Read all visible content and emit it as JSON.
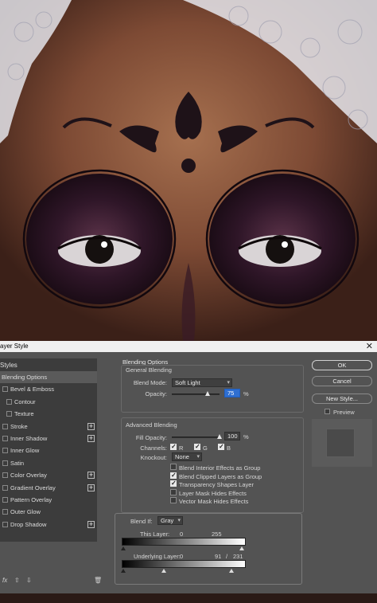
{
  "dialog": {
    "title": "ayer Style",
    "close_icon": "close-icon"
  },
  "style_list": {
    "header": "Styles",
    "items": [
      {
        "label": "Blending Options",
        "checkbox": false,
        "plus": false,
        "indent": 0,
        "selected": true
      },
      {
        "label": "Bevel & Emboss",
        "checkbox": true,
        "plus": false,
        "indent": 0
      },
      {
        "label": "Contour",
        "checkbox": true,
        "plus": false,
        "indent": 1
      },
      {
        "label": "Texture",
        "checkbox": true,
        "plus": false,
        "indent": 1
      },
      {
        "label": "Stroke",
        "checkbox": true,
        "plus": true,
        "indent": 0
      },
      {
        "label": "Inner Shadow",
        "checkbox": true,
        "plus": true,
        "indent": 0
      },
      {
        "label": "Inner Glow",
        "checkbox": true,
        "plus": false,
        "indent": 0
      },
      {
        "label": "Satin",
        "checkbox": true,
        "plus": false,
        "indent": 0
      },
      {
        "label": "Color Overlay",
        "checkbox": true,
        "plus": true,
        "indent": 0
      },
      {
        "label": "Gradient Overlay",
        "checkbox": true,
        "plus": true,
        "indent": 0
      },
      {
        "label": "Pattern Overlay",
        "checkbox": true,
        "plus": false,
        "indent": 0
      },
      {
        "label": "Outer Glow",
        "checkbox": true,
        "plus": false,
        "indent": 0
      },
      {
        "label": "Drop Shadow",
        "checkbox": true,
        "plus": true,
        "indent": 0
      }
    ],
    "fx_label": "fx",
    "fx_dot": ".",
    "up_icon": "arrow-up-icon",
    "down_icon": "arrow-down-icon",
    "trash_icon": "trash-icon"
  },
  "blending": {
    "section_title": "Blending Options",
    "general_title": "General Blending",
    "blend_mode_label": "Blend Mode:",
    "blend_mode_value": "Soft Light",
    "opacity_label": "Opacity:",
    "opacity_value": "75",
    "opacity_fraction": 0.75,
    "percent": "%",
    "advanced_title": "Advanced Blending",
    "fill_opacity_label": "Fill Opacity:",
    "fill_opacity_value": "100",
    "fill_fraction": 1.0,
    "channels_label": "Channels:",
    "channel_r": "R",
    "channel_g": "G",
    "channel_b": "B",
    "knockout_label": "Knockout:",
    "knockout_value": "None",
    "options": [
      {
        "label": "Blend Interior Effects as Group",
        "checked": false
      },
      {
        "label": "Blend Clipped Layers as Group",
        "checked": true
      },
      {
        "label": "Transparency Shapes Layer",
        "checked": true
      },
      {
        "label": "Layer Mask Hides Effects",
        "checked": false
      },
      {
        "label": "Vector Mask Hides Effects",
        "checked": false
      }
    ],
    "blend_if_label": "Blend If:",
    "blend_if_value": "Gray",
    "this_layer_label": "This Layer:",
    "this_layer_min": "0",
    "this_layer_max": "255",
    "underlying_label": "Underlying Layer:",
    "underlying_min": "0",
    "underlying_split_a": "91",
    "underlying_slash": "/",
    "underlying_split_b": "231"
  },
  "buttons": {
    "ok": "OK",
    "cancel": "Cancel",
    "new_style": "New Style...",
    "preview": "Preview"
  },
  "colors": {
    "dialog_bg": "#535353",
    "list_bg": "#3c3c3c",
    "highlight": "#2f6fd1"
  }
}
